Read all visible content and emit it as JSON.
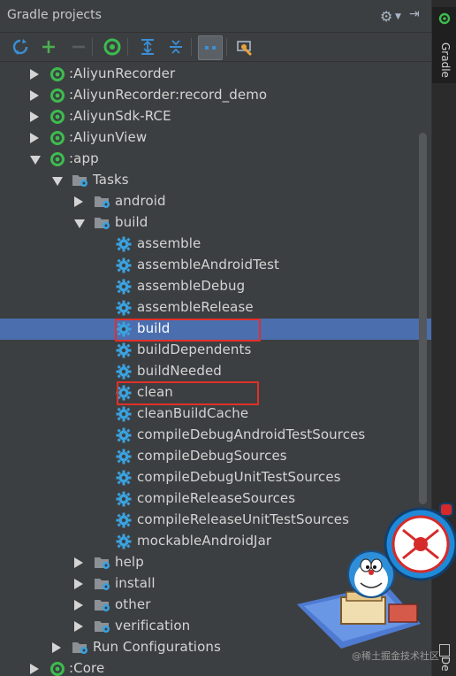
{
  "panel": {
    "title": "Gradle projects"
  },
  "toolbar": {
    "buttons": [
      "refresh-all-icon",
      "add-icon",
      "remove-icon",
      "execute-task-icon",
      "expand-all-icon",
      "collapse-all-icon",
      "group-modules-icon",
      "settings-wrench-icon"
    ]
  },
  "tree": {
    "rows": [
      {
        "label": ":AliyunRecorder",
        "depth": 1,
        "arrow": "right",
        "icon": "gradle-module-icon"
      },
      {
        "label": ":AliyunRecorder:record_demo",
        "depth": 1,
        "arrow": "right",
        "icon": "gradle-module-icon"
      },
      {
        "label": ":AliyunSdk-RCE",
        "depth": 1,
        "arrow": "right",
        "icon": "gradle-module-icon"
      },
      {
        "label": ":AliyunView",
        "depth": 1,
        "arrow": "right",
        "icon": "gradle-module-icon"
      },
      {
        "label": ":app",
        "depth": 1,
        "arrow": "down",
        "icon": "gradle-module-icon"
      },
      {
        "label": "Tasks",
        "depth": 2,
        "arrow": "down",
        "icon": "folder-gear-icon"
      },
      {
        "label": "android",
        "depth": 3,
        "arrow": "right",
        "icon": "folder-gear-icon"
      },
      {
        "label": "build",
        "depth": 3,
        "arrow": "down",
        "icon": "folder-gear-icon"
      },
      {
        "label": "assemble",
        "depth": 4,
        "arrow": "",
        "icon": "gear-icon"
      },
      {
        "label": "assembleAndroidTest",
        "depth": 4,
        "arrow": "",
        "icon": "gear-icon"
      },
      {
        "label": "assembleDebug",
        "depth": 4,
        "arrow": "",
        "icon": "gear-icon"
      },
      {
        "label": "assembleRelease",
        "depth": 4,
        "arrow": "",
        "icon": "gear-icon"
      },
      {
        "label": "build",
        "depth": 4,
        "arrow": "",
        "icon": "gear-icon",
        "selected": true
      },
      {
        "label": "buildDependents",
        "depth": 4,
        "arrow": "",
        "icon": "gear-icon"
      },
      {
        "label": "buildNeeded",
        "depth": 4,
        "arrow": "",
        "icon": "gear-icon"
      },
      {
        "label": "clean",
        "depth": 4,
        "arrow": "",
        "icon": "gear-icon"
      },
      {
        "label": "cleanBuildCache",
        "depth": 4,
        "arrow": "",
        "icon": "gear-icon"
      },
      {
        "label": "compileDebugAndroidTestSources",
        "depth": 4,
        "arrow": "",
        "icon": "gear-icon"
      },
      {
        "label": "compileDebugSources",
        "depth": 4,
        "arrow": "",
        "icon": "gear-icon"
      },
      {
        "label": "compileDebugUnitTestSources",
        "depth": 4,
        "arrow": "",
        "icon": "gear-icon"
      },
      {
        "label": "compileReleaseSources",
        "depth": 4,
        "arrow": "",
        "icon": "gear-icon"
      },
      {
        "label": "compileReleaseUnitTestSources",
        "depth": 4,
        "arrow": "",
        "icon": "gear-icon"
      },
      {
        "label": "mockableAndroidJar",
        "depth": 4,
        "arrow": "",
        "icon": "gear-icon"
      },
      {
        "label": "help",
        "depth": 3,
        "arrow": "right",
        "icon": "folder-gear-icon"
      },
      {
        "label": "install",
        "depth": 3,
        "arrow": "right",
        "icon": "folder-gear-icon"
      },
      {
        "label": "other",
        "depth": 3,
        "arrow": "right",
        "icon": "folder-gear-icon"
      },
      {
        "label": "verification",
        "depth": 3,
        "arrow": "right",
        "icon": "folder-gear-icon"
      },
      {
        "label": "Run Configurations",
        "depth": 2,
        "arrow": "right",
        "icon": "folder-gear-icon"
      },
      {
        "label": ":Core",
        "depth": 1,
        "arrow": "right",
        "icon": "gradle-module-icon"
      }
    ]
  },
  "sidebar": {
    "gradle_tab": "Gradle",
    "bottom_tab": "De"
  },
  "watermark": "@稀土掘金技术社区",
  "colors": {
    "background": "#3c3f41",
    "selection": "#4b6eaf",
    "highlight_box": "#e0302a",
    "gradle_green": "#3dbb4f",
    "gear_blue": "#3aa2e0"
  }
}
